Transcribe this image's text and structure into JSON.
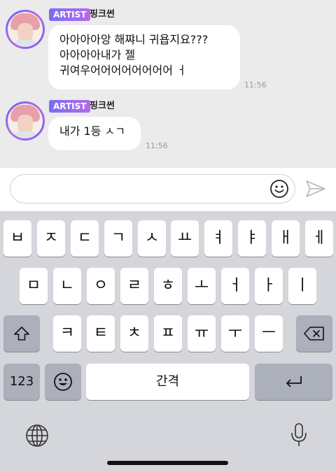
{
  "messages": [
    {
      "badge": "ARTIST",
      "sender": "핑크썬",
      "text": "아아아아앙 해쨔니 귀욥지요???\n아아아아내가 젤\n귀여우어어어어어어어어 ㅓ",
      "time": "11:56"
    },
    {
      "badge": "ARTIST",
      "sender": "핑크썬",
      "text": "내가 1등 ㅅㄱ",
      "time": "11:56"
    }
  ],
  "input": {
    "placeholder": ""
  },
  "keyboard": {
    "row1": [
      "ㅂ",
      "ㅈ",
      "ㄷ",
      "ㄱ",
      "ㅅ",
      "ㅛ",
      "ㅕ",
      "ㅑ",
      "ㅐ",
      "ㅔ"
    ],
    "row2": [
      "ㅁ",
      "ㄴ",
      "ㅇ",
      "ㄹ",
      "ㅎ",
      "ㅗ",
      "ㅓ",
      "ㅏ",
      "ㅣ"
    ],
    "row3": [
      "ㅋ",
      "ㅌ",
      "ㅊ",
      "ㅍ",
      "ㅠ",
      "ㅜ",
      "ㅡ"
    ],
    "numbers_label": "123",
    "space_label": "간격"
  },
  "colors": {
    "accent": "#8a63ea",
    "keyboard_bg": "#d4d6dc",
    "chat_bg": "#ebebeb"
  },
  "icons": [
    "smile-icon",
    "send-icon",
    "shift-icon",
    "backspace-icon",
    "emoji-icon",
    "return-icon",
    "globe-icon",
    "microphone-icon"
  ]
}
